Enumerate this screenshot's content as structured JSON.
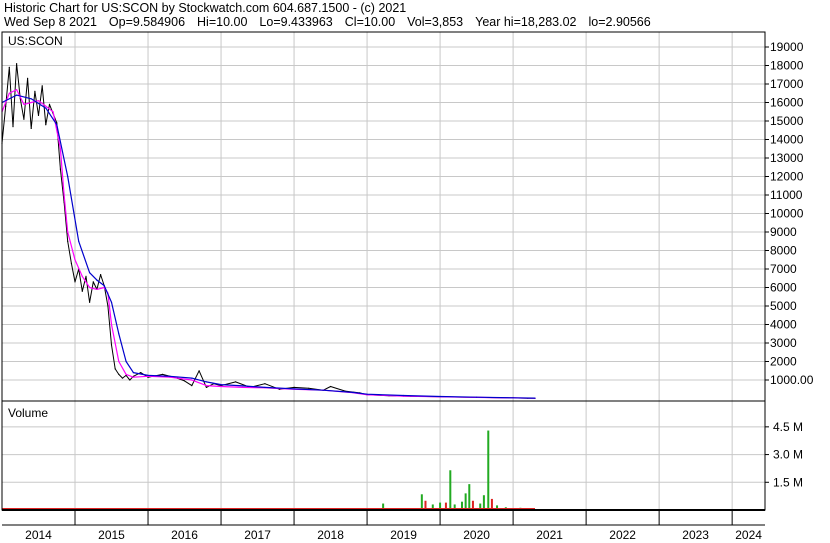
{
  "header": {
    "line1": "Historic Chart for US:SCON by Stockwatch.com 604.687.1500 - (c) 2021",
    "date": "Wed Sep  8 2021",
    "open": "Op=9.584906",
    "high": "Hi=10.00",
    "low": "Lo=9.433963",
    "close": "Cl=10.00",
    "volume": "Vol=3,853",
    "year_high": "Year hi=18,283.02",
    "year_low": "lo=2.90566"
  },
  "colors": {
    "price": "#000000",
    "ma_short": "#ff00ff",
    "ma_long": "#0000cc",
    "vol_up": "#22aa22",
    "vol_down": "#dd2222",
    "grid": "#c8c8c8"
  },
  "chart_data": [
    {
      "type": "line",
      "title": "US:SCON",
      "xlabel": "",
      "ylabel": "",
      "x_tick_labels": [
        "2014",
        "2015",
        "2016",
        "2017",
        "2018",
        "2019",
        "2020",
        "2021",
        "2022",
        "2023",
        "2024"
      ],
      "y_tick_labels": [
        "1000.00",
        "2000",
        "3000",
        "4000",
        "5000",
        "6000",
        "7000",
        "8000",
        "9000",
        "10000",
        "11000",
        "12000",
        "13000",
        "14000",
        "15000",
        "16000",
        "17000",
        "18000",
        "19000"
      ],
      "ylim": [
        0,
        19500
      ],
      "grid": true,
      "series": [
        {
          "role": "price",
          "x": [
            2014.0,
            2014.05,
            2014.1,
            2014.15,
            2014.2,
            2014.25,
            2014.3,
            2014.35,
            2014.4,
            2014.45,
            2014.5,
            2014.55,
            2014.6,
            2014.65,
            2014.7,
            2014.75,
            2014.8,
            2014.85,
            2014.9,
            2014.95,
            2015.0,
            2015.05,
            2015.1,
            2015.15,
            2015.2,
            2015.25,
            2015.3,
            2015.35,
            2015.4,
            2015.45,
            2015.5,
            2015.55,
            2015.6,
            2015.65,
            2015.7,
            2015.75,
            2015.8,
            2015.9,
            2016.0,
            2016.2,
            2016.4,
            2016.5,
            2016.6,
            2016.7,
            2016.8,
            2016.9,
            2017.0,
            2017.2,
            2017.4,
            2017.6,
            2017.8,
            2018.0,
            2018.2,
            2018.4,
            2018.5,
            2018.7,
            2018.9,
            2019.0,
            2019.3,
            2019.6,
            2020.0,
            2020.5,
            2021.0,
            2021.2,
            2021.3
          ],
          "y": [
            13800,
            15800,
            17900,
            14700,
            18100,
            16200,
            15100,
            17300,
            14600,
            16600,
            15300,
            16900,
            14800,
            15900,
            15400,
            14900,
            12400,
            10600,
            8500,
            7300,
            6300,
            7000,
            5800,
            6600,
            5200,
            6300,
            5900,
            6700,
            6100,
            5000,
            2900,
            1600,
            1300,
            1100,
            1250,
            1000,
            1200,
            1400,
            1150,
            1300,
            1100,
            950,
            700,
            1500,
            600,
            800,
            700,
            900,
            600,
            800,
            500,
            600,
            550,
            450,
            650,
            400,
            300,
            200,
            150,
            120,
            90,
            60,
            30,
            15,
            10
          ]
        },
        {
          "role": "moving-average-short",
          "x": [
            2014.0,
            2014.1,
            2014.2,
            2014.3,
            2014.4,
            2014.5,
            2014.6,
            2014.7,
            2014.8,
            2014.85,
            2014.9,
            2015.0,
            2015.1,
            2015.2,
            2015.3,
            2015.4,
            2015.45,
            2015.5,
            2015.6,
            2015.7,
            2015.8,
            2016.0,
            2016.3,
            2016.6,
            2016.8,
            2017.0,
            2017.3,
            2017.6,
            2018.0,
            2018.4,
            2018.8,
            2019.0,
            2019.5,
            2020.0,
            2020.5,
            2021.0,
            2021.3
          ],
          "y": [
            15500,
            16500,
            16700,
            15900,
            16000,
            16100,
            15800,
            15500,
            13500,
            11000,
            9000,
            7500,
            6600,
            6000,
            5900,
            6000,
            5700,
            4000,
            2000,
            1300,
            1150,
            1200,
            1150,
            1000,
            700,
            650,
            600,
            580,
            500,
            450,
            320,
            200,
            130,
            90,
            60,
            30,
            15
          ]
        },
        {
          "role": "moving-average-long",
          "x": [
            2014.0,
            2014.2,
            2014.4,
            2014.6,
            2014.75,
            2014.9,
            2015.05,
            2015.2,
            2015.3,
            2015.4,
            2015.5,
            2015.6,
            2015.7,
            2015.8,
            2016.0,
            2016.3,
            2016.6,
            2016.8,
            2017.0,
            2017.3,
            2017.6,
            2018.0,
            2018.4,
            2018.8,
            2019.0,
            2019.5,
            2020.0,
            2020.5,
            2021.0,
            2021.3
          ],
          "y": [
            16000,
            16400,
            16200,
            15700,
            14800,
            12000,
            8500,
            6800,
            6400,
            6100,
            5200,
            3500,
            2000,
            1400,
            1250,
            1200,
            1100,
            900,
            750,
            680,
            600,
            520,
            450,
            330,
            230,
            160,
            110,
            70,
            40,
            20
          ]
        }
      ]
    },
    {
      "type": "bar",
      "title": "Volume",
      "y_tick_labels": [
        "1.5 M",
        "3.0 M",
        "4.5 M"
      ],
      "ylim": [
        0,
        6000000
      ],
      "grid": true,
      "bars": [
        {
          "x": 2019.22,
          "value": 350000,
          "dir": "up"
        },
        {
          "x": 2019.75,
          "value": 850000,
          "dir": "up"
        },
        {
          "x": 2019.8,
          "value": 500000,
          "dir": "down"
        },
        {
          "x": 2019.9,
          "value": 300000,
          "dir": "up"
        },
        {
          "x": 2020.0,
          "value": 400000,
          "dir": "up"
        },
        {
          "x": 2020.08,
          "value": 400000,
          "dir": "down"
        },
        {
          "x": 2020.14,
          "value": 2150000,
          "dir": "up"
        },
        {
          "x": 2020.2,
          "value": 300000,
          "dir": "up"
        },
        {
          "x": 2020.3,
          "value": 450000,
          "dir": "up"
        },
        {
          "x": 2020.35,
          "value": 900000,
          "dir": "up"
        },
        {
          "x": 2020.4,
          "value": 1400000,
          "dir": "up"
        },
        {
          "x": 2020.45,
          "value": 500000,
          "dir": "down"
        },
        {
          "x": 2020.55,
          "value": 350000,
          "dir": "up"
        },
        {
          "x": 2020.6,
          "value": 800000,
          "dir": "up"
        },
        {
          "x": 2020.66,
          "value": 4300000,
          "dir": "up"
        },
        {
          "x": 2020.71,
          "value": 600000,
          "dir": "down"
        },
        {
          "x": 2020.78,
          "value": 250000,
          "dir": "up"
        },
        {
          "x": 2020.9,
          "value": 150000,
          "dir": "up"
        },
        {
          "x": 2021.1,
          "value": 120000,
          "dir": "up"
        }
      ]
    }
  ]
}
